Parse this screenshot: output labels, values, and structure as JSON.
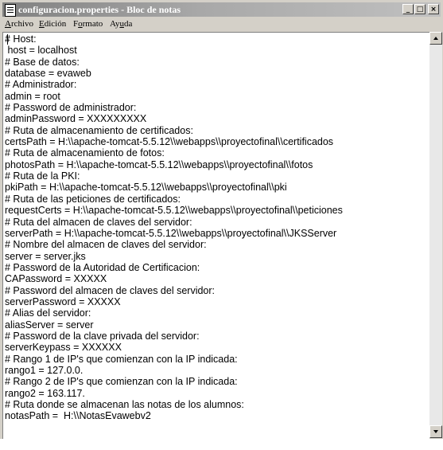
{
  "window": {
    "title": "configuracion.properties - Bloc de notas"
  },
  "title_buttons": {
    "minimize": "_",
    "maximize": "□",
    "close": "×"
  },
  "menu": [
    {
      "prefix": "",
      "accel": "A",
      "rest": "rchivo"
    },
    {
      "prefix": "",
      "accel": "E",
      "rest": "dición"
    },
    {
      "prefix": "F",
      "accel": "o",
      "rest": "rmato"
    },
    {
      "prefix": "Ay",
      "accel": "u",
      "rest": "da"
    }
  ],
  "editor": {
    "lines": [
      "# Host:",
      " host = localhost",
      "# Base de datos:",
      "database = evaweb",
      "# Administrador:",
      "admin = root",
      "# Password de administrador:",
      "adminPassword = XXXXXXXXX",
      "# Ruta de almacenamiento de certificados:",
      "certsPath = H:\\\\apache-tomcat-5.5.12\\\\webapps\\\\proyectofinal\\\\certificados",
      "# Ruta de almacenamiento de fotos:",
      "photosPath = H:\\\\apache-tomcat-5.5.12\\\\webapps\\\\proyectofinal\\\\fotos",
      "# Ruta de la PKI:",
      "pkiPath = H:\\\\apache-tomcat-5.5.12\\\\webapps\\\\proyectofinal\\\\pki",
      "# Ruta de las peticiones de certificados:",
      "requestCerts = H:\\\\apache-tomcat-5.5.12\\\\webapps\\\\proyectofinal\\\\peticiones",
      "# Ruta del almacen de claves del servidor:",
      "serverPath = H:\\\\apache-tomcat-5.5.12\\\\webapps\\\\proyectofinal\\\\JKSServer",
      "# Nombre del almacen de claves del servidor:",
      "server = server.jks",
      "# Password de la Autoridad de Certificacion:",
      "CAPassword = XXXXX",
      "# Password del almacen de claves del servidor:",
      "serverPassword = XXXXX",
      "# Alias del servidor:",
      "aliasServer = server",
      "# Password de la clave privada del servidor:",
      "serverKeypass = XXXXXX",
      "# Rango 1 de IP's que comienzan con la IP indicada:",
      "rango1 = 127.0.0.",
      "# Rango 2 de IP's que comienzan con la IP indicada:",
      "rango2 = 163.117.",
      "# Ruta donde se almacenan las notas de los alumnos:",
      "notasPath =  H:\\\\NotasEvawebv2"
    ]
  }
}
